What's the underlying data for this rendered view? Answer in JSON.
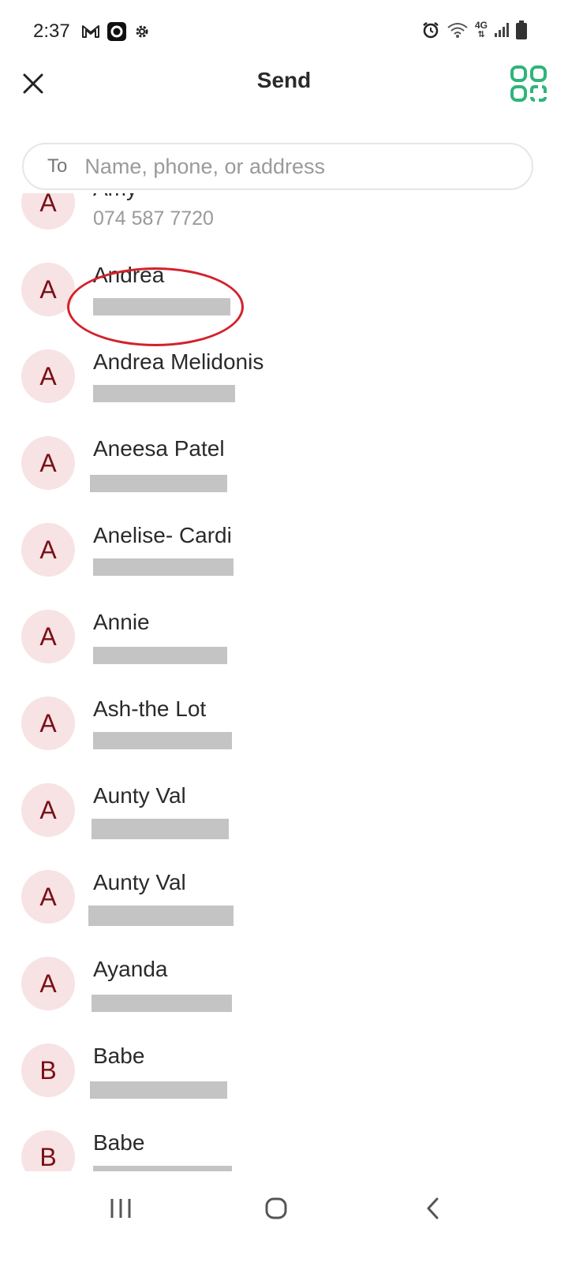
{
  "status_bar": {
    "time": "2:37",
    "left_icons": [
      "gmail-icon",
      "camera-app-icon",
      "settings-icon"
    ],
    "right_icons": [
      "alarm-icon",
      "wifi-icon",
      "4g-icon",
      "signal-icon",
      "battery-icon"
    ],
    "network_label": "4G"
  },
  "header": {
    "title": "Send",
    "close_icon": "close-icon",
    "qr_icon": "qr-scan-icon",
    "accent_color": "#2fb57a"
  },
  "search": {
    "to_label": "To",
    "placeholder": "Name, phone, or address",
    "value": ""
  },
  "contacts": [
    {
      "initial": "A",
      "name": "Amy",
      "detail": "074 587 7720",
      "detail_redacted": false
    },
    {
      "initial": "A",
      "name": "Andrea",
      "detail": "",
      "detail_redacted": true,
      "highlighted": true
    },
    {
      "initial": "A",
      "name": "Andrea Melidonis",
      "detail": "",
      "detail_redacted": true
    },
    {
      "initial": "A",
      "name": "Aneesa Patel",
      "detail": "",
      "detail_redacted": true
    },
    {
      "initial": "A",
      "name": "Anelise- Cardi",
      "detail": "",
      "detail_redacted": true
    },
    {
      "initial": "A",
      "name": "Annie",
      "detail": "",
      "detail_redacted": true
    },
    {
      "initial": "A",
      "name": "Ash-the Lot",
      "detail": "",
      "detail_redacted": true
    },
    {
      "initial": "A",
      "name": "Aunty Val",
      "detail": "",
      "detail_redacted": true
    },
    {
      "initial": "A",
      "name": "Aunty Val",
      "detail": "",
      "detail_redacted": true
    },
    {
      "initial": "A",
      "name": "Ayanda",
      "detail": "",
      "detail_redacted": true
    },
    {
      "initial": "B",
      "name": "Babe",
      "detail": "",
      "detail_redacted": true
    },
    {
      "initial": "B",
      "name": "Babe",
      "detail": "",
      "detail_redacted": true
    }
  ],
  "colors": {
    "avatar_bg": "#f7e3e4",
    "avatar_text": "#7a0f17",
    "annotation": "#d4212b",
    "redaction": "#c4c4c4"
  },
  "nav_bar": {
    "buttons": [
      "recents-icon",
      "home-icon",
      "back-icon"
    ]
  }
}
